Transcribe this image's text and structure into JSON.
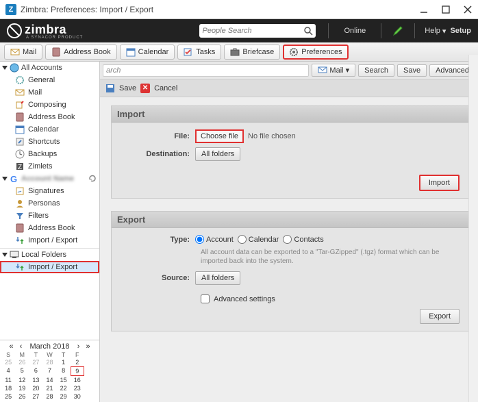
{
  "window": {
    "title": "Zimbra: Preferences: Import / Export"
  },
  "masthead": {
    "brand": "zimbra",
    "sub": "A SYNACOR PRODUCT",
    "search_placeholder": "People Search",
    "online": "Online",
    "help": "Help",
    "setup": "Setup"
  },
  "app_tabs": {
    "mail": "Mail",
    "address": "Address Book",
    "calendar": "Calendar",
    "tasks": "Tasks",
    "briefcase": "Briefcase",
    "preferences": "Preferences"
  },
  "sidebar": {
    "all_accounts": "All Accounts",
    "items": [
      {
        "label": "General"
      },
      {
        "label": "Mail"
      },
      {
        "label": "Composing"
      },
      {
        "label": "Address Book"
      },
      {
        "label": "Calendar"
      },
      {
        "label": "Shortcuts"
      },
      {
        "label": "Backups"
      },
      {
        "label": "Zimlets"
      }
    ],
    "account_items": [
      {
        "label": "Signatures"
      },
      {
        "label": "Personas"
      },
      {
        "label": "Filters"
      },
      {
        "label": "Address Book"
      },
      {
        "label": "Import / Export"
      }
    ],
    "local_folders": "Local Folders",
    "local_items": [
      {
        "label": "Import / Export"
      }
    ]
  },
  "toolbar": {
    "search_placeholder": "arch",
    "mail_menu": "Mail",
    "search": "Search",
    "save": "Save",
    "advanced": "Advanced"
  },
  "toolbar2": {
    "save": "Save",
    "cancel": "Cancel"
  },
  "import_panel": {
    "title": "Import",
    "file_label": "File:",
    "choose_file": "Choose file",
    "no_file": "No file chosen",
    "dest_label": "Destination:",
    "dest_value": "All folders",
    "import_btn": "Import"
  },
  "export_panel": {
    "title": "Export",
    "type_label": "Type:",
    "type_account": "Account",
    "type_calendar": "Calendar",
    "type_contacts": "Contacts",
    "desc": "All account data can be exported to a \"Tar-GZipped\" (.tgz) format which can be imported back into the system.",
    "source_label": "Source:",
    "source_value": "All folders",
    "advanced": "Advanced settings",
    "export_btn": "Export"
  },
  "calendar": {
    "title": "March 2018",
    "dow": [
      "S",
      "M",
      "T",
      "W",
      "T",
      "F"
    ],
    "rows": [
      [
        "25",
        "26",
        "27",
        "28",
        "1",
        "2"
      ],
      [
        "4",
        "5",
        "6",
        "7",
        "8",
        "9"
      ],
      [
        "11",
        "12",
        "13",
        "14",
        "15",
        "16"
      ],
      [
        "18",
        "19",
        "20",
        "21",
        "22",
        "23"
      ],
      [
        "25",
        "26",
        "27",
        "28",
        "29",
        "30"
      ]
    ],
    "other_month_cells": [
      0,
      1,
      2,
      3
    ],
    "today_index": 11
  }
}
